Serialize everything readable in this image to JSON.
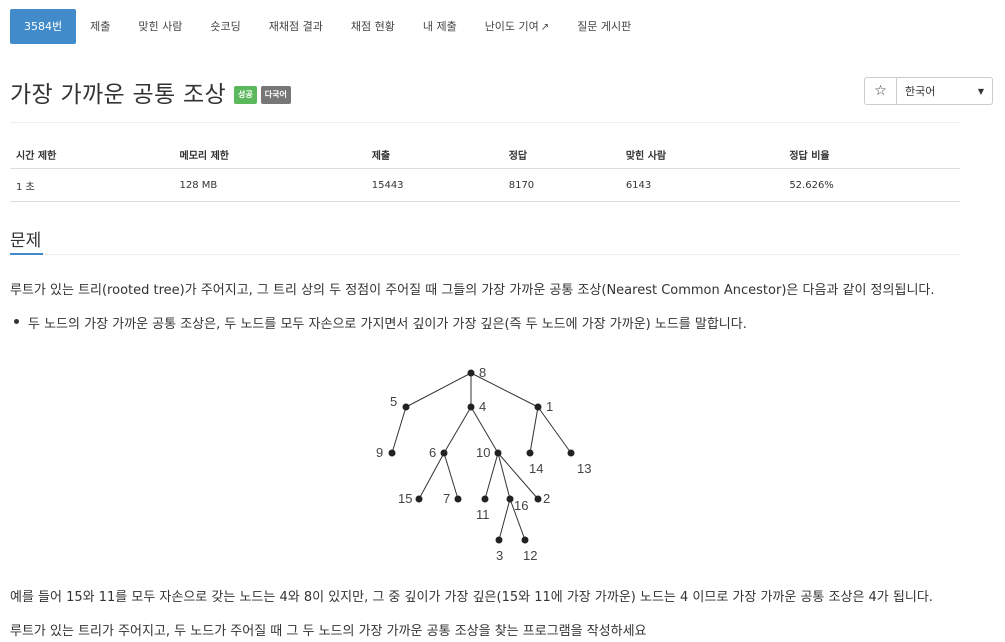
{
  "tabs": [
    {
      "label": "3584번",
      "active": true
    },
    {
      "label": "제출"
    },
    {
      "label": "맞힌 사람"
    },
    {
      "label": "숏코딩"
    },
    {
      "label": "재채점 결과"
    },
    {
      "label": "채점 현황"
    },
    {
      "label": "내 제출"
    },
    {
      "label": "난이도 기여",
      "external_icon": "external-link-icon"
    },
    {
      "label": "질문 게시판"
    }
  ],
  "problem": {
    "title": "가장 가까운 공통 조상",
    "badge_success": "성공",
    "badge_lang": "다국어"
  },
  "controls": {
    "star_icon": "☆",
    "language": "한국어"
  },
  "info_table": {
    "headers": [
      "시간 제한",
      "메모리 제한",
      "제출",
      "정답",
      "맞힌 사람",
      "정답 비율"
    ],
    "row": [
      "1 초",
      "128 MB",
      "15443",
      "8170",
      "6143",
      "52.626%"
    ]
  },
  "section": {
    "heading": "문제",
    "p1": "루트가 있는 트리(rooted tree)가 주어지고, 그 트리 상의 두 정점이 주어질 때 그들의 가장 가까운 공통 조상(Nearest Common Ancestor)은 다음과 같이 정의됩니다.",
    "bullet": "두 노드의 가장 가까운 공통 조상은, 두 노드를 모두 자손으로 가지면서 깊이가 가장 깊은(즉 두 노드에 가장 가까운) 노드를 말합니다.",
    "p2": "예를 들어 15와 11를 모두 자손으로 갖는 노드는 4와 8이 있지만, 그 중 깊이가 가장 깊은(15와 11에 가장 가까운) 노드는 4 이므로 가장 가까운 공통 조상은 4가 됩니다.",
    "p3": "루트가 있는 트리가 주어지고, 두 노드가 주어질 때 그 두 노드의 가장 가까운 공통 조상을 찾는 프로그램을 작성하세요"
  },
  "tree": {
    "nodes": [
      "8",
      "5",
      "4",
      "1",
      "9",
      "6",
      "10",
      "14",
      "13",
      "15",
      "7",
      "11",
      "16",
      "2",
      "3",
      "12"
    ],
    "edges": [
      [
        "8",
        "5"
      ],
      [
        "8",
        "4"
      ],
      [
        "8",
        "1"
      ],
      [
        "5",
        "9"
      ],
      [
        "4",
        "6"
      ],
      [
        "4",
        "10"
      ],
      [
        "1",
        "14"
      ],
      [
        "1",
        "13"
      ],
      [
        "6",
        "15"
      ],
      [
        "6",
        "7"
      ],
      [
        "10",
        "11"
      ],
      [
        "10",
        "16"
      ],
      [
        "10",
        "2"
      ],
      [
        "16",
        "3"
      ],
      [
        "16",
        "12"
      ]
    ]
  },
  "colors": {
    "accent": "#428bca",
    "success": "#5cb85c",
    "badge_gray": "#777777"
  }
}
